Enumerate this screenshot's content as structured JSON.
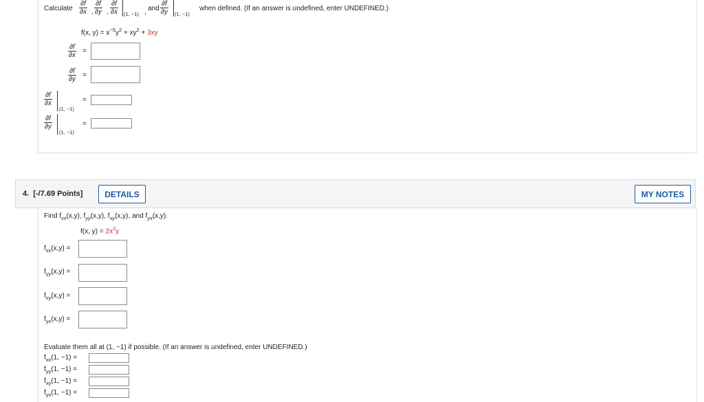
{
  "q3": {
    "calculate": "Calculate",
    "partial_f": "∂f",
    "partial_x": "∂x",
    "partial_y": "∂y",
    "comma": ",",
    "and": "and",
    "point": "(1, −1)",
    "when_defined": "when defined. (If an answer is undefined, enter UNDEFINED.)",
    "function_prefix": "f(x, y) = x",
    "function_exp": "−5",
    "function_mid1": "y",
    "function_exp2": "2",
    "function_mid2": " + xy",
    "function_exp3": "2",
    "function_mid3": " + ",
    "function_red": "3xy",
    "equals": "="
  },
  "q4": {
    "title": "4.  [-/7.69 Points]",
    "details_label": "DETAILS",
    "my_notes_label": "MY NOTES",
    "find_text_prefix": "Find f",
    "find_parts": [
      "xx",
      "(x,y), f",
      "yy",
      "(x,y), f",
      "xy",
      "(x,y), and f",
      "yx",
      "(x,y)."
    ],
    "function_prefix": "f(x, y) = ",
    "function_red": "2x",
    "function_red_exp": "2",
    "function_suffix": "y",
    "answers": [
      {
        "f": "f",
        "sub": "xx",
        "args": "(x,y) ="
      },
      {
        "f": "f",
        "sub": "yy",
        "args": "(x,y) ="
      },
      {
        "f": "f",
        "sub": "xy",
        "args": "(x,y) ="
      },
      {
        "f": "f",
        "sub": "yx",
        "args": "(x,y) ="
      }
    ],
    "evaluate_text": "Evaluate them all at (1, −1) if possible. (If an answer is undefined, enter UNDEFINED.)",
    "evaluations": [
      {
        "f": "f",
        "sub": "xx",
        "args": "(1, −1) ="
      },
      {
        "f": "f",
        "sub": "yy",
        "args": "(1, −1) ="
      },
      {
        "f": "f",
        "sub": "xy",
        "args": "(1, −1) ="
      },
      {
        "f": "f",
        "sub": "yx",
        "args": "(1, −1) ="
      }
    ]
  }
}
